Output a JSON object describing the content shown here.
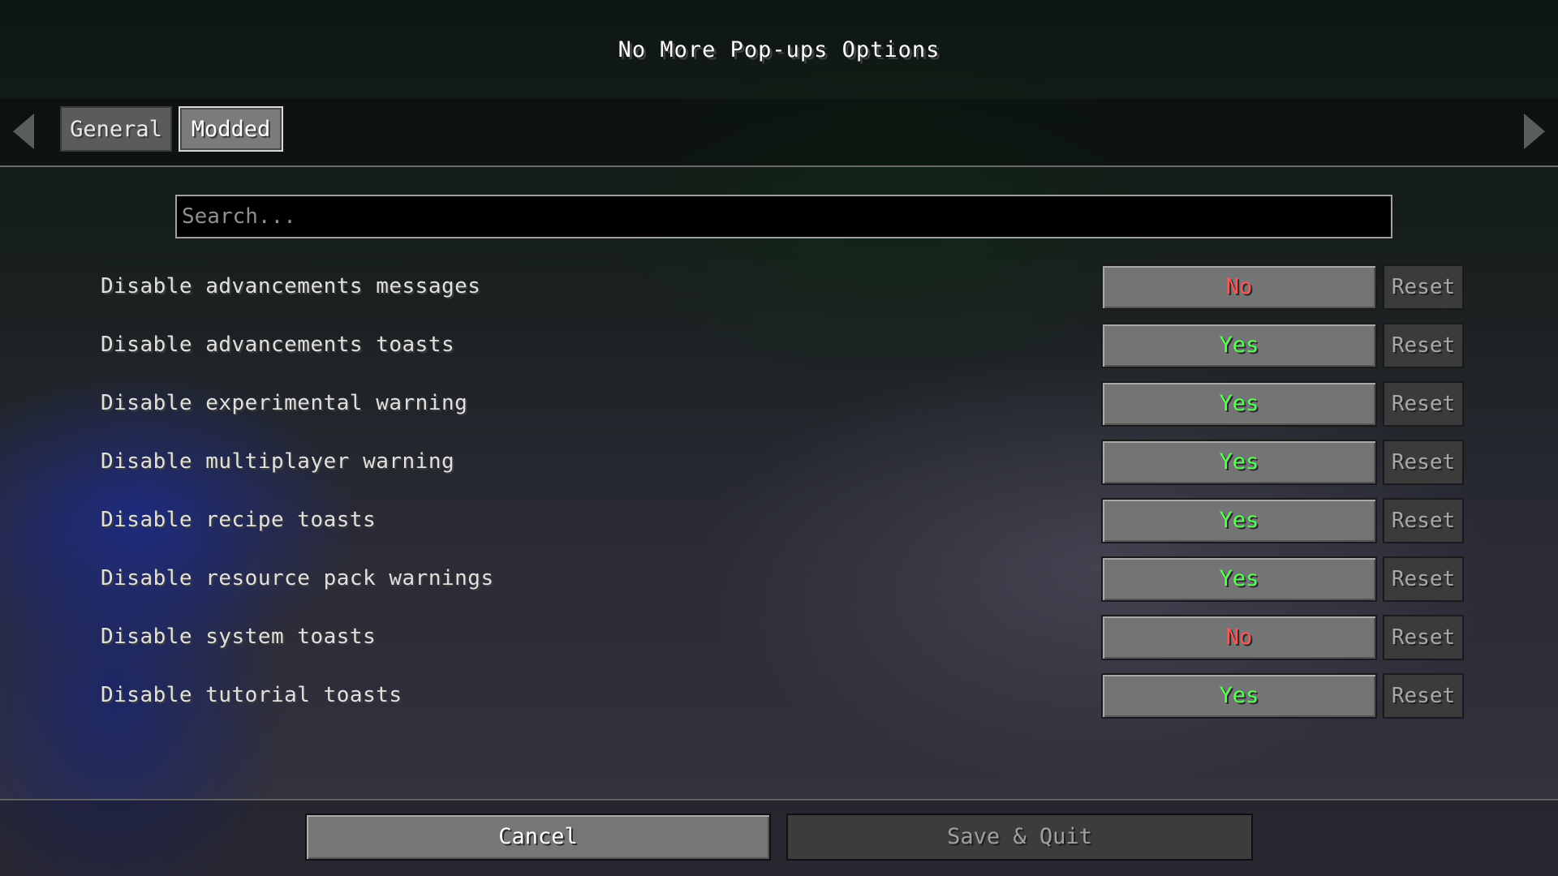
{
  "title": "No More Pop-ups Options",
  "tabs": [
    {
      "label": "General",
      "selected": false
    },
    {
      "label": "Modded",
      "selected": true
    }
  ],
  "search": {
    "placeholder": "Search...",
    "value": ""
  },
  "options": [
    {
      "label": "Disable advancements messages",
      "value": "No",
      "reset_label": "Reset"
    },
    {
      "label": "Disable advancements toasts",
      "value": "Yes",
      "reset_label": "Reset"
    },
    {
      "label": "Disable experimental warning",
      "value": "Yes",
      "reset_label": "Reset"
    },
    {
      "label": "Disable multiplayer warning",
      "value": "Yes",
      "reset_label": "Reset"
    },
    {
      "label": "Disable recipe toasts",
      "value": "Yes",
      "reset_label": "Reset"
    },
    {
      "label": "Disable resource pack warnings",
      "value": "Yes",
      "reset_label": "Reset"
    },
    {
      "label": "Disable system toasts",
      "value": "No",
      "reset_label": "Reset"
    },
    {
      "label": "Disable tutorial toasts",
      "value": "Yes",
      "reset_label": "Reset"
    }
  ],
  "footer": {
    "cancel_label": "Cancel",
    "save_label": "Save & Quit"
  },
  "colors": {
    "yes": "#55ff55",
    "no": "#ff5555"
  },
  "icons": {
    "prev": "arrow-left-icon",
    "next": "arrow-right-icon"
  }
}
